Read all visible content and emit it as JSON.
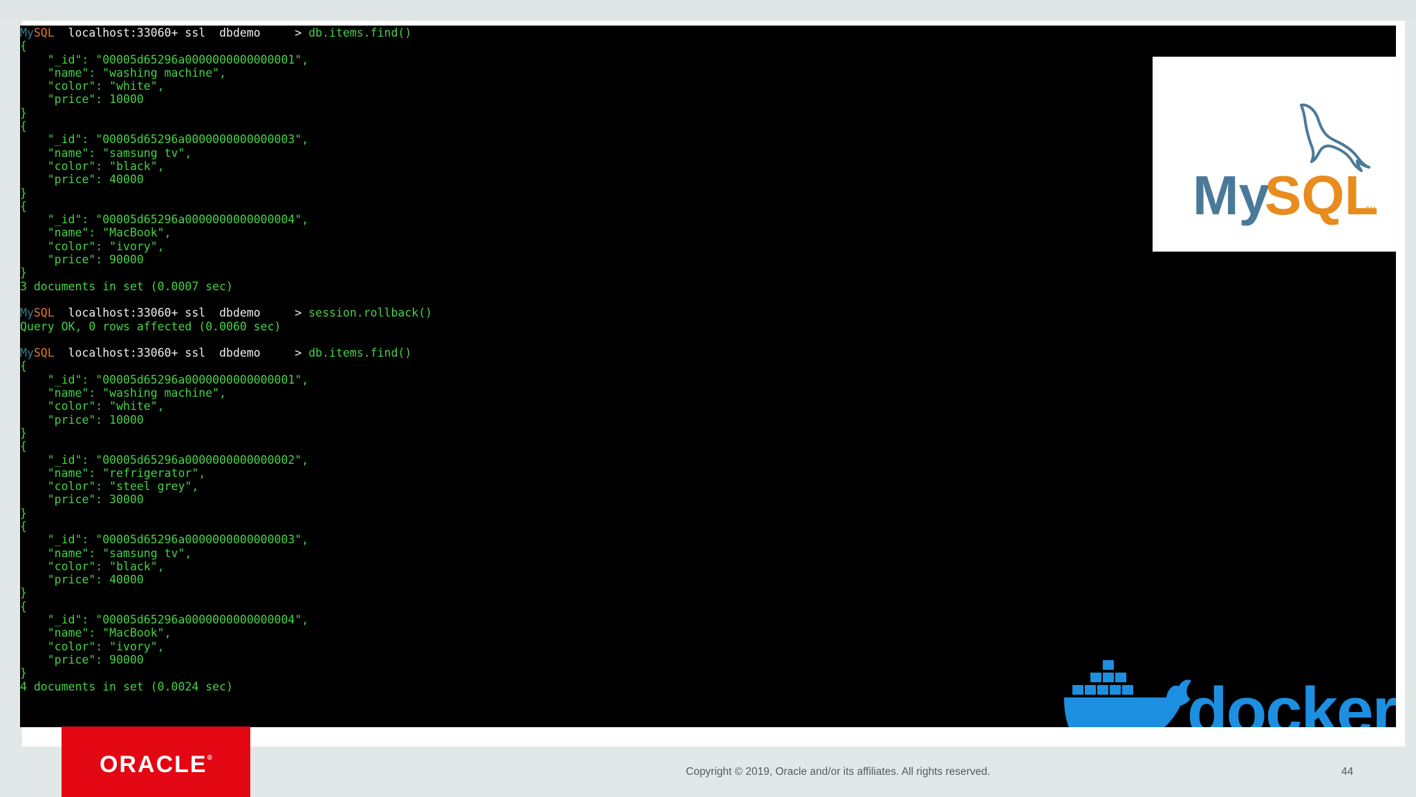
{
  "terminal": {
    "prompts": [
      {
        "mysql_a": "My",
        "mysql_b": "SQL",
        "host": "  localhost:33060+ ssl  dbdemo     > ",
        "command": "db.items.find()"
      },
      {
        "mysql_a": "My",
        "mysql_b": "SQL",
        "host": "  localhost:33060+ ssl  dbdemo     > ",
        "command": "session.rollback()"
      },
      {
        "mysql_a": "My",
        "mysql_b": "SQL",
        "host": "  localhost:33060+ ssl  dbdemo     > ",
        "command": "db.items.find()"
      }
    ],
    "first_result": {
      "docs": [
        {
          "id": "    \"_id\": \"00005d65296a0000000000000001\",",
          "name": "    \"name\": \"washing machine\",",
          "color": "    \"color\": \"white\",",
          "price": "    \"price\": 10000"
        },
        {
          "id": "    \"_id\": \"00005d65296a0000000000000003\",",
          "name": "    \"name\": \"samsung tv\",",
          "color": "    \"color\": \"black\",",
          "price": "    \"price\": 40000"
        },
        {
          "id": "    \"_id\": \"00005d65296a0000000000000004\",",
          "name": "    \"name\": \"MacBook\",",
          "color": "    \"color\": \"ivory\",",
          "price": "    \"price\": 90000"
        }
      ],
      "summary": "3 documents in set (0.0007 sec)"
    },
    "rollback_result": "Query OK, 0 rows affected (0.0060 sec)",
    "second_result": {
      "docs": [
        {
          "id": "    \"_id\": \"00005d65296a0000000000000001\",",
          "name": "    \"name\": \"washing machine\",",
          "color": "    \"color\": \"white\",",
          "price": "    \"price\": 10000"
        },
        {
          "id": "    \"_id\": \"00005d65296a0000000000000002\",",
          "name": "    \"name\": \"refrigerator\",",
          "color": "    \"color\": \"steel grey\",",
          "price": "    \"price\": 30000"
        },
        {
          "id": "    \"_id\": \"00005d65296a0000000000000003\",",
          "name": "    \"name\": \"samsung tv\",",
          "color": "    \"color\": \"black\",",
          "price": "    \"price\": 40000"
        },
        {
          "id": "    \"_id\": \"00005d65296a0000000000000004\",",
          "name": "    \"name\": \"MacBook\",",
          "color": "    \"color\": \"ivory\",",
          "price": "    \"price\": 90000"
        }
      ],
      "summary": "4 documents in set (0.0024 sec)"
    },
    "open_brace": "{",
    "close_brace": "}"
  },
  "logos": {
    "mysql_a": "My",
    "mysql_b": "SQL",
    "mysql_tm": "TM",
    "docker": "docker",
    "oracle": "ORACLE",
    "oracle_reg": "®"
  },
  "footer": {
    "copyright": "Copyright © 2019, Oracle and/or its affiliates. All rights reserved.",
    "page_number": "44"
  },
  "colors": {
    "mysql_blue": "#4b7a99",
    "mysql_orange": "#e88c1e",
    "docker_blue": "#1d8fe1",
    "oracle_red": "#e30613",
    "terminal_green": "#46d246"
  }
}
